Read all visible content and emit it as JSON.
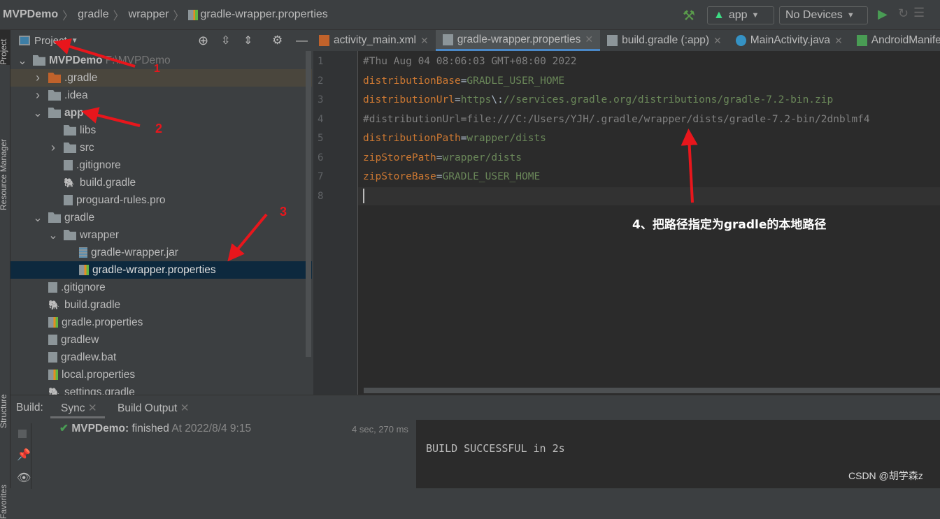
{
  "breadcrumb": [
    "MVPDemo",
    "gradle",
    "wrapper",
    "gradle-wrapper.properties"
  ],
  "toolbar": {
    "config": "app",
    "device": "No Devices"
  },
  "side_labels": {
    "project": "Project",
    "resource_manager": "Resource Manager",
    "structure": "Structure",
    "favorites": "Favorites"
  },
  "project_panel": {
    "title": "Project"
  },
  "tree": [
    {
      "label": "MVPDemo",
      "suffix": "F:\\MVPDemo",
      "depth": 0,
      "chev": "v",
      "icon": "module",
      "bold": true
    },
    {
      "label": ".gradle",
      "depth": 1,
      "chev": ">",
      "icon": "folder-orange"
    },
    {
      "label": ".idea",
      "depth": 1,
      "chev": ">",
      "icon": "folder"
    },
    {
      "label": "app",
      "depth": 1,
      "chev": "v",
      "icon": "folder-module",
      "bold": true
    },
    {
      "label": "libs",
      "depth": 2,
      "chev": "",
      "icon": "folder"
    },
    {
      "label": "src",
      "depth": 2,
      "chev": ">",
      "icon": "folder"
    },
    {
      "label": ".gitignore",
      "depth": 2,
      "chev": "",
      "icon": "file"
    },
    {
      "label": "build.gradle",
      "depth": 2,
      "chev": "",
      "icon": "gradle"
    },
    {
      "label": "proguard-rules.pro",
      "depth": 2,
      "chev": "",
      "icon": "file"
    },
    {
      "label": "gradle",
      "depth": 1,
      "chev": "v",
      "icon": "folder"
    },
    {
      "label": "wrapper",
      "depth": 2,
      "chev": "v",
      "icon": "folder"
    },
    {
      "label": "gradle-wrapper.jar",
      "depth": 3,
      "chev": "",
      "icon": "jar"
    },
    {
      "label": "gradle-wrapper.properties",
      "depth": 3,
      "chev": "",
      "icon": "properties",
      "selected": true
    },
    {
      "label": ".gitignore",
      "depth": 1,
      "chev": "",
      "icon": "file"
    },
    {
      "label": "build.gradle",
      "depth": 1,
      "chev": "",
      "icon": "gradle"
    },
    {
      "label": "gradle.properties",
      "depth": 1,
      "chev": "",
      "icon": "properties"
    },
    {
      "label": "gradlew",
      "depth": 1,
      "chev": "",
      "icon": "file"
    },
    {
      "label": "gradlew.bat",
      "depth": 1,
      "chev": "",
      "icon": "file"
    },
    {
      "label": "local.properties",
      "depth": 1,
      "chev": "",
      "icon": "properties"
    },
    {
      "label": "settings.gradle",
      "depth": 1,
      "chev": "",
      "icon": "gradle"
    }
  ],
  "tabs": [
    {
      "label": "activity_main.xml",
      "icon": "xml"
    },
    {
      "label": "gradle-wrapper.properties",
      "icon": "properties",
      "active": true
    },
    {
      "label": "build.gradle (:app)",
      "icon": "gradle"
    },
    {
      "label": "MainActivity.java",
      "icon": "class"
    },
    {
      "label": "AndroidManifest.xml",
      "icon": "manifest"
    }
  ],
  "code": [
    {
      "n": "1",
      "parts": [
        [
          "c",
          "#Thu Aug 04 08:06:03 GMT+08:00 2022"
        ]
      ]
    },
    {
      "n": "2",
      "parts": [
        [
          "k",
          "distributionBase"
        ],
        [
          "eq",
          "="
        ],
        [
          "v",
          "GRADLE_USER_HOME"
        ]
      ]
    },
    {
      "n": "3",
      "parts": [
        [
          "k",
          "distributionUrl"
        ],
        [
          "eq",
          "="
        ],
        [
          "v",
          "https"
        ],
        [
          "eq",
          "\\:"
        ],
        [
          "v",
          "//services.gradle.org/distributions/gradle-7.2-bin.zip"
        ]
      ]
    },
    {
      "n": "4",
      "parts": [
        [
          "c",
          "#distributionUrl=file:///C:/Users/YJH/.gradle/wrapper/dists/gradle-7.2-bin/2dnblmf4"
        ]
      ]
    },
    {
      "n": "5",
      "parts": [
        [
          "k",
          "distributionPath"
        ],
        [
          "eq",
          "="
        ],
        [
          "v",
          "wrapper/dists"
        ]
      ]
    },
    {
      "n": "6",
      "parts": [
        [
          "k",
          "zipStorePath"
        ],
        [
          "eq",
          "="
        ],
        [
          "v",
          "wrapper/dists"
        ]
      ]
    },
    {
      "n": "7",
      "parts": [
        [
          "k",
          "zipStoreBase"
        ],
        [
          "eq",
          "="
        ],
        [
          "v",
          "GRADLE_USER_HOME"
        ]
      ]
    },
    {
      "n": "8",
      "parts": []
    }
  ],
  "annotations": {
    "n1": "1",
    "n2": "2",
    "n3": "3",
    "note": "4、把路径指定为gradle的本地路径"
  },
  "build": {
    "label": "Build:",
    "tabs": [
      "Sync",
      "Build Output"
    ],
    "project": "MVPDemo:",
    "status": "finished",
    "time": "At 2022/8/4 9:15",
    "duration": "4 sec, 270 ms",
    "output": "BUILD SUCCESSFUL in 2s"
  },
  "watermark": "CSDN @胡学森z",
  "colors": {
    "keyword": "#cc7832",
    "value": "#6a8759",
    "comment": "#808080",
    "selection": "#0d293e",
    "accent": "#4a88c7",
    "arrow": "#e8161c"
  }
}
